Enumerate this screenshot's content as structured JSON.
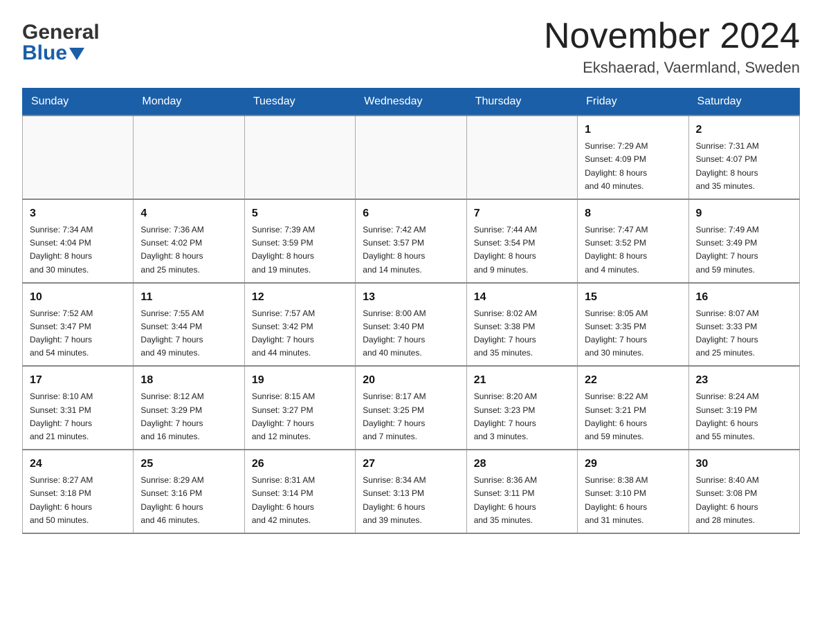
{
  "header": {
    "logo": {
      "general": "General",
      "blue": "Blue"
    },
    "title": "November 2024",
    "location": "Ekshaerad, Vaermland, Sweden"
  },
  "weekdays": [
    "Sunday",
    "Monday",
    "Tuesday",
    "Wednesday",
    "Thursday",
    "Friday",
    "Saturday"
  ],
  "weeks": [
    {
      "days": [
        {
          "num": "",
          "info": ""
        },
        {
          "num": "",
          "info": ""
        },
        {
          "num": "",
          "info": ""
        },
        {
          "num": "",
          "info": ""
        },
        {
          "num": "",
          "info": ""
        },
        {
          "num": "1",
          "info": "Sunrise: 7:29 AM\nSunset: 4:09 PM\nDaylight: 8 hours\nand 40 minutes."
        },
        {
          "num": "2",
          "info": "Sunrise: 7:31 AM\nSunset: 4:07 PM\nDaylight: 8 hours\nand 35 minutes."
        }
      ]
    },
    {
      "days": [
        {
          "num": "3",
          "info": "Sunrise: 7:34 AM\nSunset: 4:04 PM\nDaylight: 8 hours\nand 30 minutes."
        },
        {
          "num": "4",
          "info": "Sunrise: 7:36 AM\nSunset: 4:02 PM\nDaylight: 8 hours\nand 25 minutes."
        },
        {
          "num": "5",
          "info": "Sunrise: 7:39 AM\nSunset: 3:59 PM\nDaylight: 8 hours\nand 19 minutes."
        },
        {
          "num": "6",
          "info": "Sunrise: 7:42 AM\nSunset: 3:57 PM\nDaylight: 8 hours\nand 14 minutes."
        },
        {
          "num": "7",
          "info": "Sunrise: 7:44 AM\nSunset: 3:54 PM\nDaylight: 8 hours\nand 9 minutes."
        },
        {
          "num": "8",
          "info": "Sunrise: 7:47 AM\nSunset: 3:52 PM\nDaylight: 8 hours\nand 4 minutes."
        },
        {
          "num": "9",
          "info": "Sunrise: 7:49 AM\nSunset: 3:49 PM\nDaylight: 7 hours\nand 59 minutes."
        }
      ]
    },
    {
      "days": [
        {
          "num": "10",
          "info": "Sunrise: 7:52 AM\nSunset: 3:47 PM\nDaylight: 7 hours\nand 54 minutes."
        },
        {
          "num": "11",
          "info": "Sunrise: 7:55 AM\nSunset: 3:44 PM\nDaylight: 7 hours\nand 49 minutes."
        },
        {
          "num": "12",
          "info": "Sunrise: 7:57 AM\nSunset: 3:42 PM\nDaylight: 7 hours\nand 44 minutes."
        },
        {
          "num": "13",
          "info": "Sunrise: 8:00 AM\nSunset: 3:40 PM\nDaylight: 7 hours\nand 40 minutes."
        },
        {
          "num": "14",
          "info": "Sunrise: 8:02 AM\nSunset: 3:38 PM\nDaylight: 7 hours\nand 35 minutes."
        },
        {
          "num": "15",
          "info": "Sunrise: 8:05 AM\nSunset: 3:35 PM\nDaylight: 7 hours\nand 30 minutes."
        },
        {
          "num": "16",
          "info": "Sunrise: 8:07 AM\nSunset: 3:33 PM\nDaylight: 7 hours\nand 25 minutes."
        }
      ]
    },
    {
      "days": [
        {
          "num": "17",
          "info": "Sunrise: 8:10 AM\nSunset: 3:31 PM\nDaylight: 7 hours\nand 21 minutes."
        },
        {
          "num": "18",
          "info": "Sunrise: 8:12 AM\nSunset: 3:29 PM\nDaylight: 7 hours\nand 16 minutes."
        },
        {
          "num": "19",
          "info": "Sunrise: 8:15 AM\nSunset: 3:27 PM\nDaylight: 7 hours\nand 12 minutes."
        },
        {
          "num": "20",
          "info": "Sunrise: 8:17 AM\nSunset: 3:25 PM\nDaylight: 7 hours\nand 7 minutes."
        },
        {
          "num": "21",
          "info": "Sunrise: 8:20 AM\nSunset: 3:23 PM\nDaylight: 7 hours\nand 3 minutes."
        },
        {
          "num": "22",
          "info": "Sunrise: 8:22 AM\nSunset: 3:21 PM\nDaylight: 6 hours\nand 59 minutes."
        },
        {
          "num": "23",
          "info": "Sunrise: 8:24 AM\nSunset: 3:19 PM\nDaylight: 6 hours\nand 55 minutes."
        }
      ]
    },
    {
      "days": [
        {
          "num": "24",
          "info": "Sunrise: 8:27 AM\nSunset: 3:18 PM\nDaylight: 6 hours\nand 50 minutes."
        },
        {
          "num": "25",
          "info": "Sunrise: 8:29 AM\nSunset: 3:16 PM\nDaylight: 6 hours\nand 46 minutes."
        },
        {
          "num": "26",
          "info": "Sunrise: 8:31 AM\nSunset: 3:14 PM\nDaylight: 6 hours\nand 42 minutes."
        },
        {
          "num": "27",
          "info": "Sunrise: 8:34 AM\nSunset: 3:13 PM\nDaylight: 6 hours\nand 39 minutes."
        },
        {
          "num": "28",
          "info": "Sunrise: 8:36 AM\nSunset: 3:11 PM\nDaylight: 6 hours\nand 35 minutes."
        },
        {
          "num": "29",
          "info": "Sunrise: 8:38 AM\nSunset: 3:10 PM\nDaylight: 6 hours\nand 31 minutes."
        },
        {
          "num": "30",
          "info": "Sunrise: 8:40 AM\nSunset: 3:08 PM\nDaylight: 6 hours\nand 28 minutes."
        }
      ]
    }
  ]
}
